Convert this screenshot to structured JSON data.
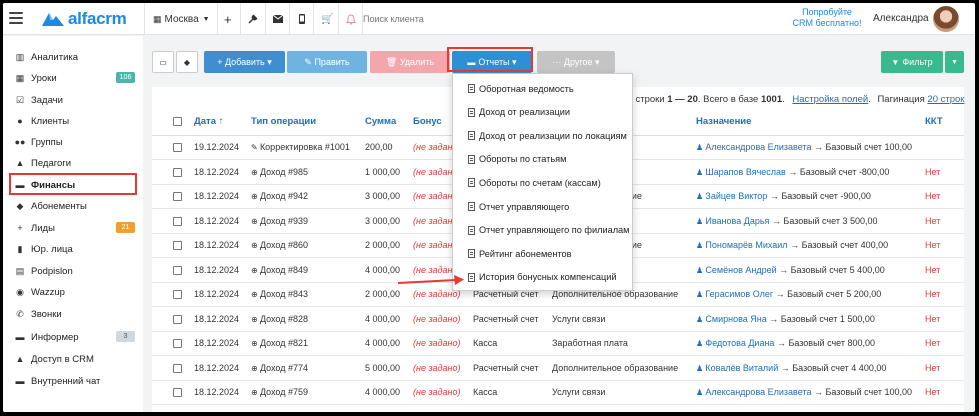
{
  "topbar": {
    "logo_text": "alfacrm",
    "branch": "Москва",
    "search_placeholder": "Поиск клиента",
    "promo_line1": "Попробуйте",
    "promo_line2": "CRM бесплатно!",
    "user_name": "Александра"
  },
  "sidebar": {
    "items": [
      {
        "label": "Аналитика",
        "icon": "analytics-icon",
        "glyph": "▥"
      },
      {
        "label": "Уроки",
        "icon": "calendar-icon",
        "glyph": "▦",
        "badge": "106",
        "badge_color": "#4db6ac"
      },
      {
        "label": "Задачи",
        "icon": "tasks-icon",
        "glyph": "☑"
      },
      {
        "label": "Клиенты",
        "icon": "user-icon",
        "glyph": "●"
      },
      {
        "label": "Группы",
        "icon": "group-icon",
        "glyph": "●●"
      },
      {
        "label": "Педагоги",
        "icon": "teacher-icon",
        "glyph": "▲"
      },
      {
        "label": "Финансы",
        "icon": "finance-icon",
        "glyph": "▬"
      },
      {
        "label": "Абонементы",
        "icon": "subscription-icon",
        "glyph": "◆"
      },
      {
        "label": "Лиды",
        "icon": "leads-icon",
        "glyph": "+",
        "badge": "21",
        "badge_color": "#f0a030"
      },
      {
        "label": "Юр. лица",
        "icon": "building-icon",
        "glyph": "▮"
      },
      {
        "label": "Podpislon",
        "icon": "document-icon",
        "glyph": "▤"
      },
      {
        "label": "Wazzup",
        "icon": "chat-icon",
        "glyph": "◉"
      },
      {
        "label": "Звонки",
        "icon": "phone-icon",
        "glyph": "✆"
      },
      {
        "label": "Информер",
        "icon": "informer-icon",
        "glyph": "▬",
        "badge": "3",
        "badge_color": "#cfd8dc"
      },
      {
        "label": "Доступ в CRM",
        "icon": "lock-icon",
        "glyph": "▲"
      },
      {
        "label": "Внутренний чат",
        "icon": "message-icon",
        "glyph": "▬"
      }
    ]
  },
  "toolbar": {
    "add_label": "+ Добавить ▾",
    "edit_label": "✎ Править",
    "delete_label": "🗑 Удалить",
    "reports_label": "Отчеты ▾",
    "other_label": "··· Другое ▾",
    "filter_label": "Фильтр"
  },
  "info_bar": {
    "text_prefix": "ы строки",
    "range": "1 — 20",
    "total_text": ". Всего в базе",
    "total": "1001",
    "settings_link": "Настройка полей",
    "pagination_label": "Пагинация",
    "pagination_value": "20 строк"
  },
  "dropdown": {
    "items": [
      "Оборотная ведомость",
      "Доход от реализации",
      "Доход от реализации по локациям",
      "Обороты по статьям",
      "Обороты по счетам (кассам)",
      "Отчет управляющего",
      "Отчет управляющего по филиалам",
      "Рейтинг абонементов",
      "История бонусных компенсаций"
    ]
  },
  "table": {
    "headers": {
      "date": "Дата ↑",
      "op_type": "Тип операции",
      "sum": "Сумма",
      "bonus": "Бонус",
      "destination": "Назначение",
      "kkt": "ККТ"
    },
    "rows": [
      {
        "date": "19.12.2024",
        "op": "Корректировка #1001",
        "sum": "200,00",
        "bonus": "(не задано)",
        "col5": "",
        "col6": "",
        "person": "Александрова Елизавета",
        "dest": "Базовый счет 100,00",
        "kkt": ""
      },
      {
        "date": "18.12.2024",
        "op": "Доход #985",
        "sum": "1 000,00",
        "bonus": "(не задано)",
        "col5": "",
        "col6": "",
        "person": "Шарапов Вячеслав",
        "dest": "Базовый счет -800,00",
        "kkt": "Нет"
      },
      {
        "date": "18.12.2024",
        "op": "Доход #942",
        "sum": "3 000,00",
        "bonus": "(не задано)",
        "col5": "",
        "col6": "тельное образование",
        "person": "Зайцев Виктор",
        "dest": "Базовый счет -900,00",
        "kkt": "Нет"
      },
      {
        "date": "18.12.2024",
        "op": "Доход #939",
        "sum": "3 000,00",
        "bonus": "(не задано)",
        "col5": "",
        "col6": "",
        "person": "Иванова Дарья",
        "dest": "Базовый счет 3 500,00",
        "kkt": "Нет"
      },
      {
        "date": "18.12.2024",
        "op": "Доход #860",
        "sum": "2 000,00",
        "bonus": "(не задано)",
        "col5": "",
        "col6": "тельное образование",
        "person": "Пономарёв Михаил",
        "dest": "Базовый счет 400,00",
        "kkt": "Нет"
      },
      {
        "date": "18.12.2024",
        "op": "Доход #849",
        "sum": "4 000,00",
        "bonus": "(не задано)",
        "col5": "",
        "col6": "ата",
        "person": "Семёнов Андрей",
        "dest": "Базовый счет 5 400,00",
        "kkt": "Нет"
      },
      {
        "date": "18.12.2024",
        "op": "Доход #843",
        "sum": "2 000,00",
        "bonus": "(не задано)",
        "col5": "Расчетный счет",
        "col6": "Дополнительное образование",
        "person": "Герасимов Олег",
        "dest": "Базовый счет 5 200,00",
        "kkt": "Нет"
      },
      {
        "date": "18.12.2024",
        "op": "Доход #828",
        "sum": "4 000,00",
        "bonus": "(не задано)",
        "col5": "Расчетный счет",
        "col6": "Услуги связи",
        "person": "Смирнова Яна",
        "dest": "Базовый счет 1 500,00",
        "kkt": "Нет"
      },
      {
        "date": "18.12.2024",
        "op": "Доход #821",
        "sum": "4 000,00",
        "bonus": "(не задано)",
        "col5": "Касса",
        "col6": "Заработная плата",
        "person": "Федотова Диана",
        "dest": "Базовый счет 800,00",
        "kkt": "Нет"
      },
      {
        "date": "18.12.2024",
        "op": "Доход #774",
        "sum": "5 000,00",
        "bonus": "(не задано)",
        "col5": "Расчетный счет",
        "col6": "Дополнительное образование",
        "person": "Ковалёв Виталий",
        "dest": "Базовый счет 4 400,00",
        "kkt": "Нет"
      },
      {
        "date": "18.12.2024",
        "op": "Доход #759",
        "sum": "4 000,00",
        "bonus": "(не задано)",
        "col5": "Касса",
        "col6": "Услуги связи",
        "person": "Александрова Елизавета",
        "dest": "Базовый счет 100,00",
        "kkt": "Нет"
      }
    ]
  },
  "colors": {
    "accent_blue": "#1e88e5",
    "add_button": "#3f8fd0",
    "edit_button": "#6fb3e3",
    "delete_button": "#f3a7ad",
    "reports_button": "#2f8fd5",
    "other_button": "#c4c4c4",
    "filter_button": "#39b98d",
    "highlight_red": "#e53935"
  }
}
